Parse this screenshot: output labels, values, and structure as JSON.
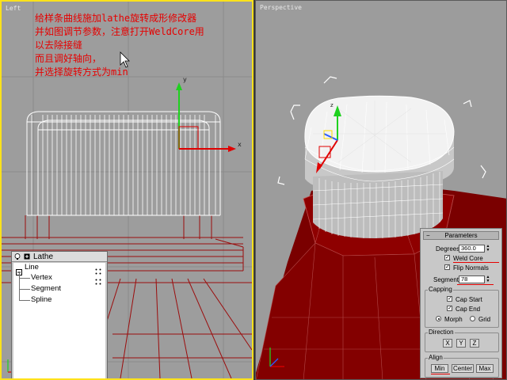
{
  "viewports": {
    "left": {
      "label": "Left"
    },
    "right": {
      "label": "Perspective"
    }
  },
  "annotation": {
    "lines": [
      "给样条曲线施加lathe旋转成形修改器",
      "并如图调节参数，注意打开WeldCore用",
      "以去除接缝",
      "而且调好轴向，",
      "并选择旋转方式为min"
    ]
  },
  "gizmo": {
    "x_label": "x",
    "y_label": "y",
    "z_label": "z"
  },
  "modifier_stack": {
    "modifier_name": "Lathe",
    "object_name": "Line",
    "subobjects": [
      "Vertex",
      "Segment",
      "Spline"
    ]
  },
  "parameters": {
    "title": "Parameters",
    "degrees_label": "Degrees:",
    "degrees_value": "360.0",
    "weld_core_label": "Weld Core",
    "weld_core_checked": true,
    "flip_normals_label": "Flip Normals",
    "flip_normals_checked": true,
    "segments_label": "Segments:",
    "segments_value": "78",
    "capping": {
      "title": "Capping",
      "cap_start_label": "Cap Start",
      "cap_start_checked": true,
      "cap_end_label": "Cap End",
      "cap_end_checked": true,
      "morph_label": "Morph",
      "grid_label": "Grid",
      "selected": "Morph"
    },
    "direction": {
      "title": "Direction",
      "buttons": [
        "X",
        "Y",
        "Z"
      ]
    },
    "align": {
      "title": "Align",
      "buttons": [
        "Min",
        "Center",
        "Max"
      ],
      "selected": "Min"
    }
  },
  "colors": {
    "annotation_red": "#e60000",
    "active_border": "#ffe21a",
    "mesh_white": "#ffffff",
    "mesh_red": "#8b0000",
    "viewport_bg": "#9d9d9d"
  }
}
